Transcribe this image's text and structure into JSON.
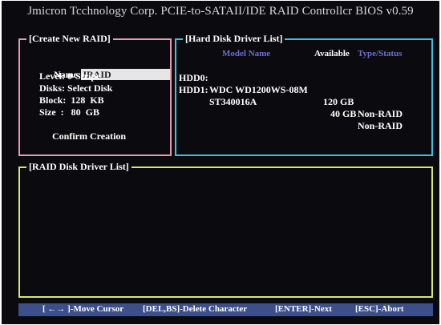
{
  "title": "Jmicron Tcchnology Corp. PCIE-to-SATAII/IDE RAID Controllcr BIOS v0.59",
  "create_panel": {
    "title": "[Create New RAID]",
    "name_label": "Name:",
    "name_value": "JRAID",
    "level": "Level: 0-Stripe",
    "disks": "Disks: Select Disk",
    "block": "Block:  128  KB",
    "size": "Size  :   80  GB",
    "confirm": "Confirm Creation"
  },
  "hdd_panel": {
    "title": "[Hard Disk Driver List]",
    "header_model": "Model Name",
    "header_available": "Available",
    "header_type": "Type/Status",
    "rows": [
      {
        "id": "HDD0:",
        "model": "WDC WD1200WS-08M",
        "available": "120 GB",
        "type": "Non-RAID"
      },
      {
        "id": "HDD1:",
        "model": "ST340016A",
        "available": "40 GB",
        "type": "Non-RAID"
      }
    ]
  },
  "raid_panel": {
    "title": "[RAID Disk Driver List]"
  },
  "footer": {
    "move": "[ ←→ ]-Move Cursor",
    "delete": "[DEL,BS]-Delete Character",
    "next": "[ENTER]-Next",
    "abort": "[ESC]-Abort"
  },
  "colors": {
    "create_border": "#e79ab0",
    "hdd_border": "#39c2e6",
    "raid_border": "#d8e86e",
    "header_accent": "#6b6fd0",
    "footer_bg": "#3d4f8b"
  }
}
